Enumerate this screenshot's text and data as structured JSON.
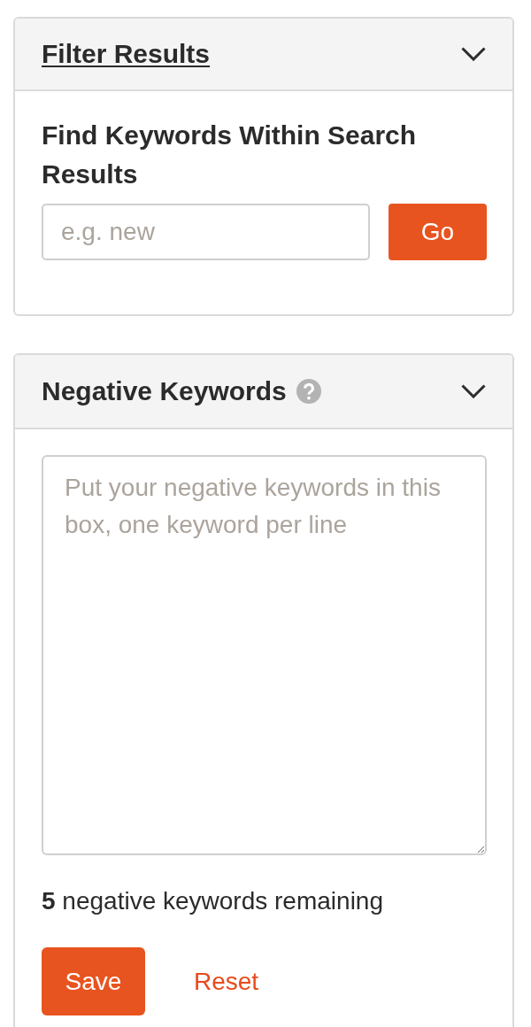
{
  "panels": [
    {
      "kind": "filter",
      "title": "Filter Results",
      "label": "Find Keywords Within Search Results",
      "search": {
        "placeholder": "e.g. new"
      },
      "button": "Go"
    },
    {
      "kind": "negative_keywords",
      "title": "Negative Keywords",
      "textarea": {
        "placeholder": "Put your negative keywords in this box, one keyword per line"
      },
      "remaining": "**5** negative keywords remaining",
      "buttons": [
        {
          "kind": "primary",
          "label": "Save"
        },
        {
          "kind": "link",
          "label": "Reset"
        }
      ]
    }
  ]
}
